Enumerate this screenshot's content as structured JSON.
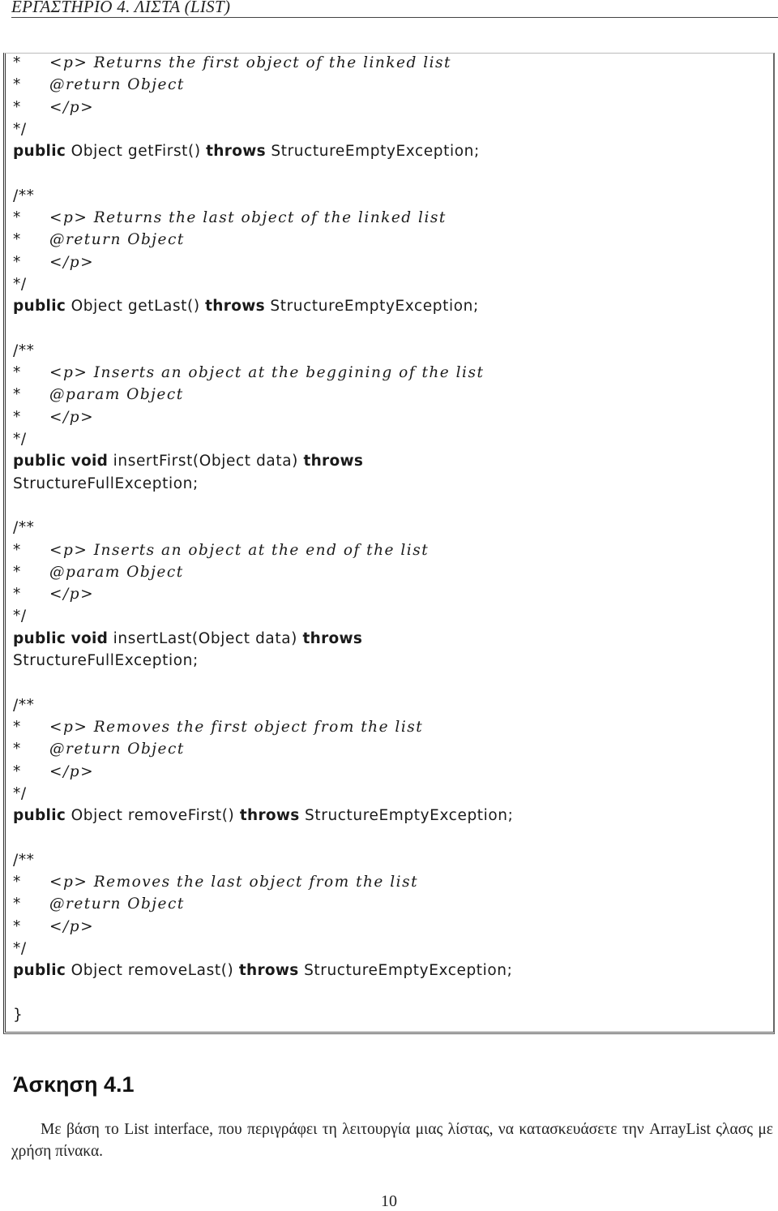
{
  "header": {
    "title": "ΕΡΓΑΣΤΗΡΙΟ 4.  ΛΙΣΤΑ (LIST)"
  },
  "code": {
    "methods": [
      {
        "open_comment": "",
        "comment": "<p> Returns the first object of the linked list",
        "tag": "@return Object",
        "close_p": "</p>",
        "end_comment": "*/",
        "sig_public": "public",
        "sig_void": "",
        "sig_rest": "Object getFirst() ",
        "sig_throws": "throws",
        "sig_exception": " StructureEmptyException;",
        "wrap_exception": ""
      },
      {
        "open_comment": "/**",
        "comment": "<p> Returns the last object of the linked list",
        "tag": "@return Object",
        "close_p": "</p>",
        "end_comment": "*/",
        "sig_public": "public",
        "sig_void": "",
        "sig_rest": "Object getLast() ",
        "sig_throws": "throws",
        "sig_exception": " StructureEmptyException;",
        "wrap_exception": ""
      },
      {
        "open_comment": "/**",
        "comment": "<p> Inserts an object at the beggining of the list",
        "tag": "@param Object",
        "close_p": "</p>",
        "end_comment": "*/",
        "sig_public": "public",
        "sig_void": "void",
        "sig_rest": "insertFirst(Object data) ",
        "sig_throws": "throws",
        "sig_exception": "",
        "wrap_exception": "StructureFullException;"
      },
      {
        "open_comment": "/**",
        "comment": "<p> Inserts an object at the end of the list",
        "tag": "@param Object",
        "close_p": "</p>",
        "end_comment": "*/",
        "sig_public": "public",
        "sig_void": "void",
        "sig_rest": "insertLast(Object data) ",
        "sig_throws": "throws",
        "sig_exception": "",
        "wrap_exception": "StructureFullException;"
      },
      {
        "open_comment": "/**",
        "comment": "<p> Removes the first object from the list",
        "tag": "@return Object",
        "close_p": "</p>",
        "end_comment": "*/",
        "sig_public": "public",
        "sig_void": "",
        "sig_rest": "Object removeFirst() ",
        "sig_throws": "throws",
        "sig_exception": " StructureEmptyException;",
        "wrap_exception": ""
      },
      {
        "open_comment": "/**",
        "comment": "<p> Removes the last object from the list",
        "tag": "@return Object",
        "close_p": "</p>",
        "end_comment": "*/",
        "sig_public": "public",
        "sig_void": "",
        "sig_rest": "Object removeLast() ",
        "sig_throws": "throws",
        "sig_exception": " StructureEmptyException;",
        "wrap_exception": ""
      }
    ],
    "star": "*",
    "closing_brace": "}"
  },
  "exercise": {
    "heading": "Άσκηση 4.1",
    "text": "Με βάση το List interface, που περιγράφει τη λειτουργία μιας λίστας, να κατασκευάσετε την ArrayList ςλασς με χρήση πίνακα."
  },
  "page_number": "10"
}
